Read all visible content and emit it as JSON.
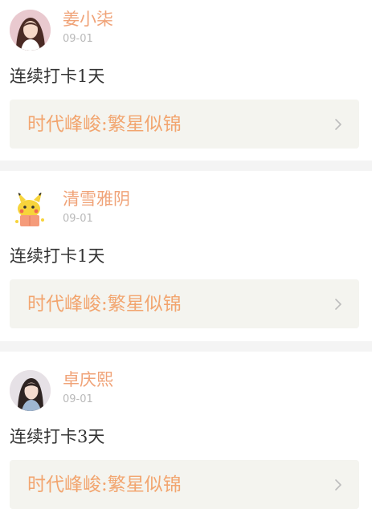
{
  "posts": [
    {
      "username": "姜小柒",
      "date": "09-01",
      "checkin": "连续打卡1天",
      "book": "时代峰峻:繁星似锦",
      "avatar_icon": "girl-portrait-avatar"
    },
    {
      "username": "清雪雅阴",
      "date": "09-01",
      "checkin": "连续打卡1天",
      "book": "时代峰峻:繁星似锦",
      "avatar_icon": "pikachu-avatar"
    },
    {
      "username": "卓庆熙",
      "date": "09-01",
      "checkin": "连续打卡3天",
      "book": "时代峰峻:繁星似锦",
      "avatar_icon": "girl-portrait-avatar"
    }
  ],
  "colors": {
    "username": "#f0a378",
    "book_title": "#f2a56f",
    "card_background": "#f4f4ef",
    "separator": "#f4f4f4",
    "date": "#b9b9b9",
    "checkin_text": "#333333"
  }
}
